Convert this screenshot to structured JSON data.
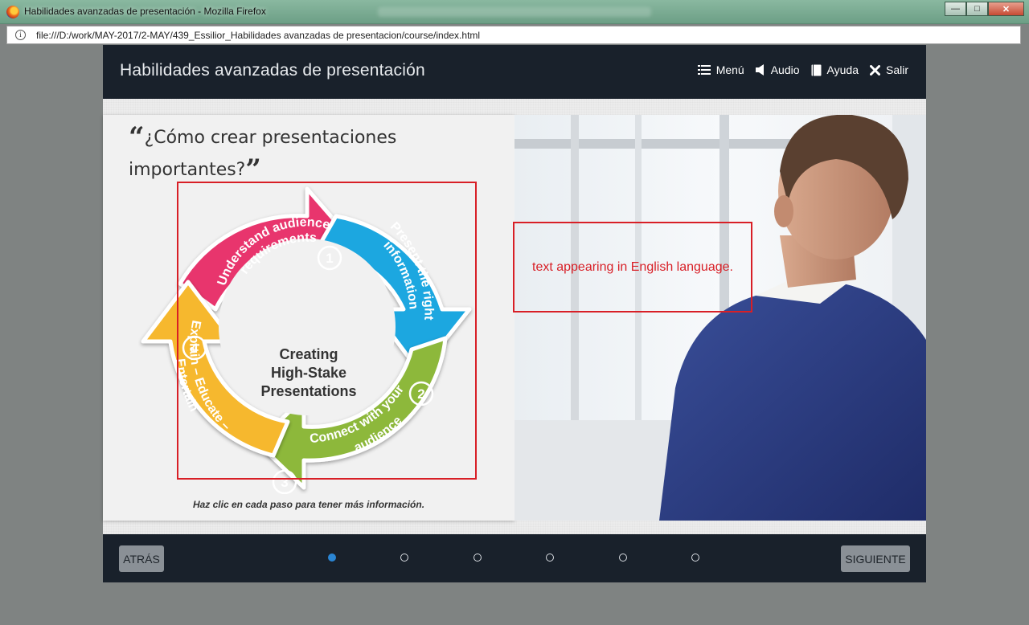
{
  "window": {
    "title": "Habilidades avanzadas de presentación - Mozilla Firefox",
    "minimize": "—",
    "maximize": "□",
    "close": "✕"
  },
  "address": {
    "url": "file:///D:/work/MAY-2017/2-MAY/439_Essilior_Habilidades avanzadas de presentacion/course/index.html"
  },
  "course": {
    "title": "Habilidades avanzadas de presentación",
    "nav": {
      "menu": "Menú",
      "audio": "Audio",
      "help": "Ayuda",
      "exit": "Salir"
    }
  },
  "slide": {
    "question": "¿Cómo crear presentaciones importantes?",
    "open_quote": "“",
    "close_quote": "”",
    "center": [
      "Creating",
      "High-Stake",
      "Presentations"
    ],
    "steps": [
      {
        "num": "1",
        "line1": "Understand audience",
        "line2": "requirements",
        "color": "#e8356d"
      },
      {
        "num": "2",
        "line1": "Present the right",
        "line2": "information",
        "color": "#1aa7e0"
      },
      {
        "num": "3",
        "line1": "Connect with your",
        "line2": "audience",
        "color": "#8db83b"
      },
      {
        "num": "4",
        "line1": "Explain – Educate –",
        "line2": "Entertain",
        "color": "#f6b82e"
      }
    ],
    "instruction": "Haz clic en cada paso para tener más información.",
    "annotation": "text appearing in English language."
  },
  "footer": {
    "back": "ATRÁS",
    "next": "SIGUIENTE",
    "pages": 6,
    "current_page": 1
  },
  "colors": {
    "header_bg": "#19212b",
    "annotation_red": "#d81f26",
    "active_dot": "#2b86d4"
  }
}
